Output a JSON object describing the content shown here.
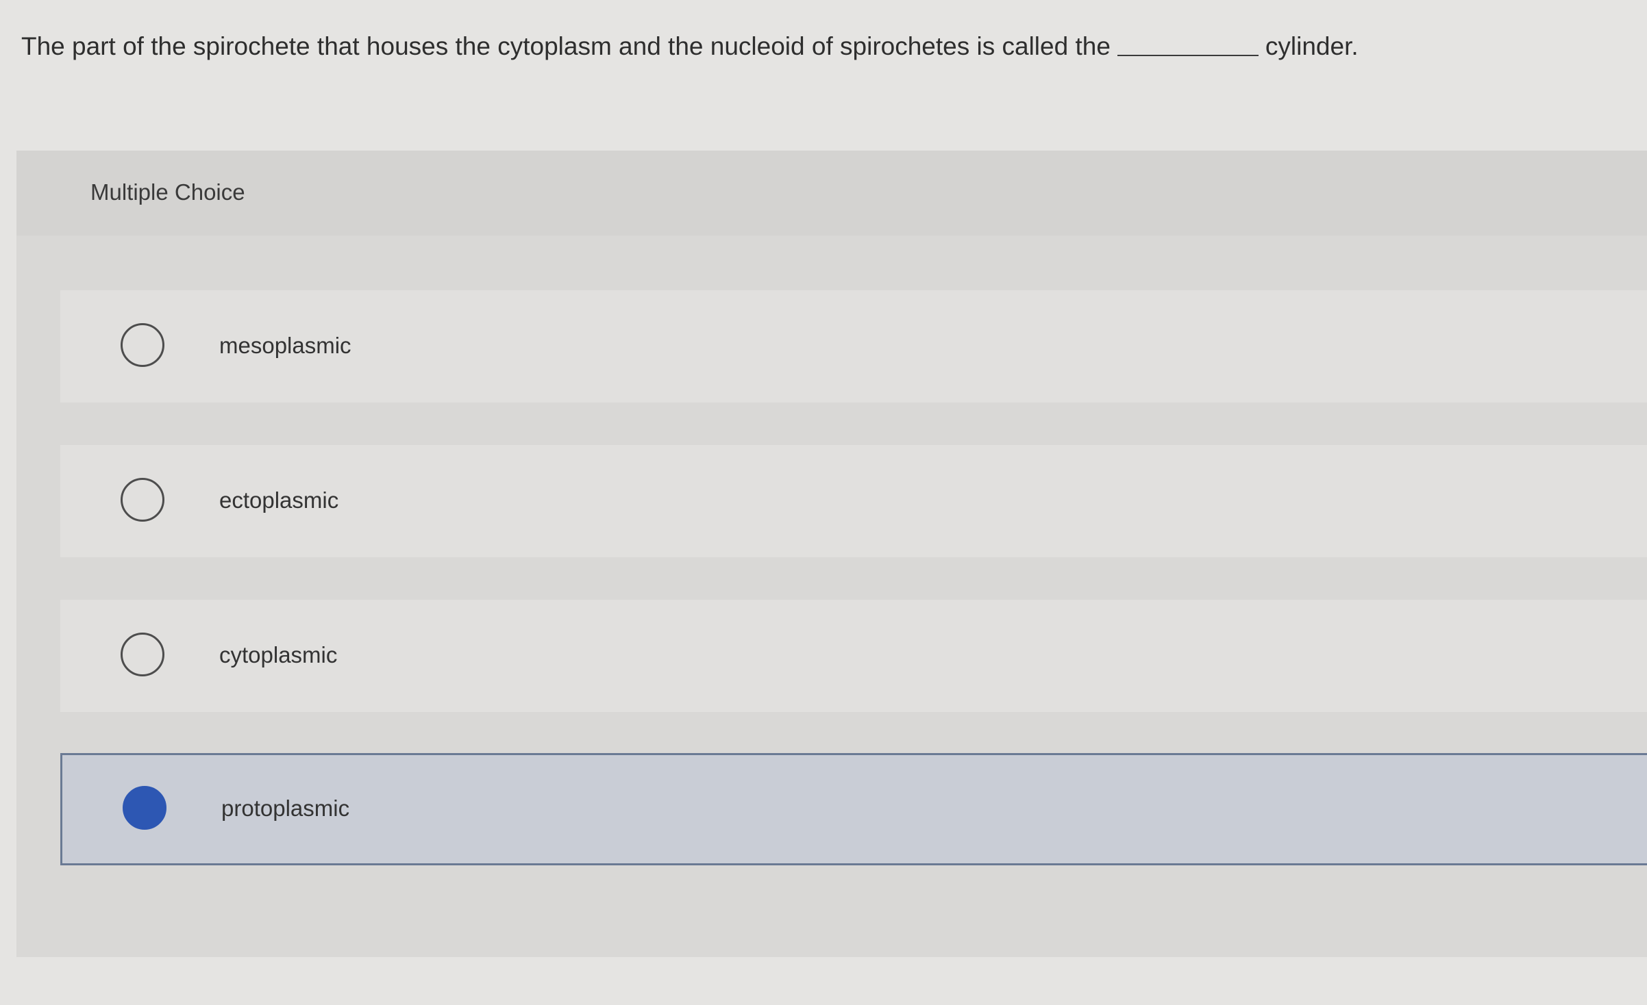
{
  "question": {
    "text_before": "The part of the spirochete that houses the cytoplasm and the nucleoid of spirochetes is called the",
    "text_after": "cylinder."
  },
  "multiple_choice": {
    "label": "Multiple Choice",
    "selected_index": 3,
    "options": [
      {
        "label": "mesoplasmic",
        "selected": false
      },
      {
        "label": "ectoplasmic",
        "selected": false
      },
      {
        "label": "cytoplasmic",
        "selected": false
      },
      {
        "label": "protoplasmic",
        "selected": true
      }
    ]
  },
  "colors": {
    "selected_fill": "#2d57b3",
    "selected_background": "#c9cdd6",
    "selected_border": "#6a7a94"
  }
}
